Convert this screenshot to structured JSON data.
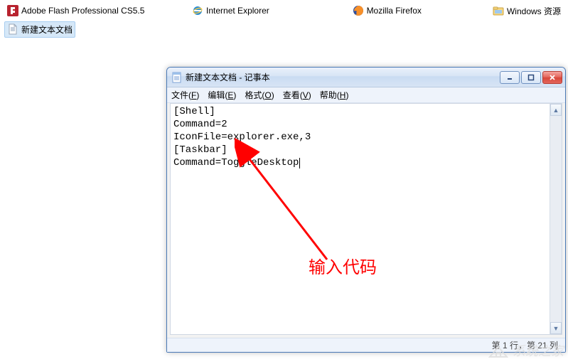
{
  "desktop": {
    "items": [
      {
        "label": "Adobe Flash Professional CS5.5"
      },
      {
        "label": "Internet Explorer"
      },
      {
        "label": "Mozilla Firefox"
      },
      {
        "label": "Windows 资源"
      },
      {
        "label": "新建文本文档"
      }
    ]
  },
  "window": {
    "title": "新建文本文档 - 记事本",
    "menu": {
      "file": {
        "label": "文件",
        "accel": "F"
      },
      "edit": {
        "label": "编辑",
        "accel": "E"
      },
      "format": {
        "label": "格式",
        "accel": "O"
      },
      "view": {
        "label": "查看",
        "accel": "V"
      },
      "help": {
        "label": "帮助",
        "accel": "H"
      }
    },
    "content_lines": [
      "[Shell]",
      "Command=2",
      "IconFile=explorer.exe,3",
      "[Taskbar]",
      "Command=ToggleDesktop"
    ],
    "statusbar": "第 1 行，第 21 列"
  },
  "annotation": {
    "text": "输入代码"
  },
  "watermark": "系统之家"
}
